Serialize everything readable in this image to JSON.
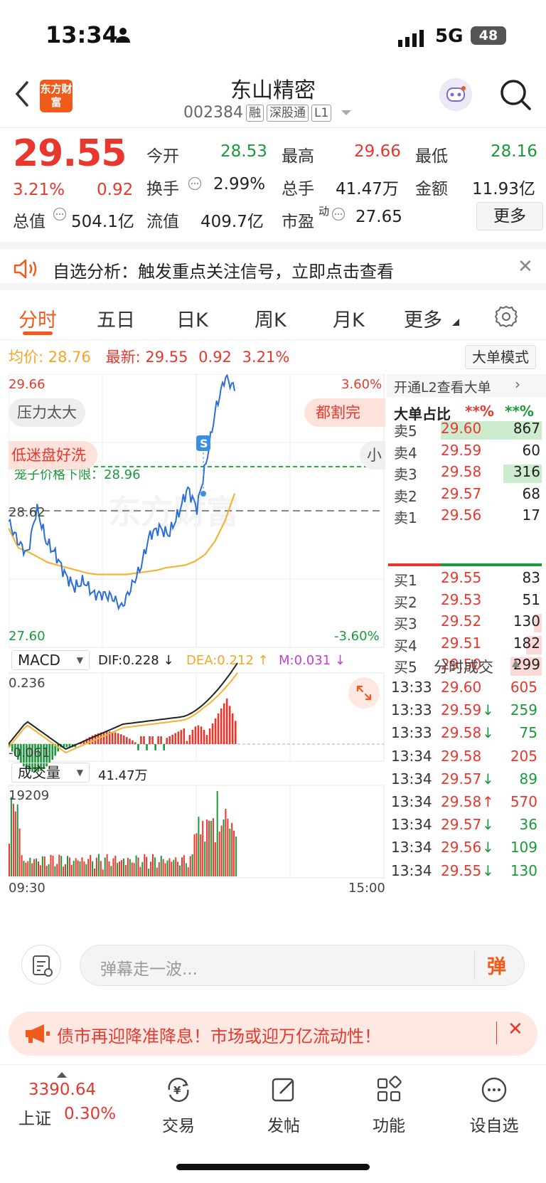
{
  "status_bar": {
    "time": "13:34",
    "network": "5G",
    "battery": "48"
  },
  "header": {
    "logo_text": "东方财富",
    "stock_name": "东山精密",
    "stock_code": "002384",
    "tags": [
      "融",
      "深股通",
      "L1"
    ]
  },
  "quote": {
    "price": "29.55",
    "change_pct": "3.21%",
    "change": "0.92",
    "open_label": "今开",
    "open": "28.53",
    "high_label": "最高",
    "high": "29.66",
    "low_label": "最低",
    "low": "28.16",
    "turnover_label": "换手",
    "turnover": "2.99%",
    "volume_label": "总手",
    "volume": "41.47万",
    "amount_label": "金额",
    "amount": "11.93亿",
    "mcap_label": "总值",
    "mcap": "504.1亿",
    "float_label": "流值",
    "float_cap": "409.7亿",
    "pe_label": "市盈",
    "pe_sup": "动",
    "pe": "27.65",
    "more_label": "更多"
  },
  "banner": {
    "text": "自选分析：触发重点关注信号，立即点击查看"
  },
  "tabs": [
    "分时",
    "五日",
    "日K",
    "周K",
    "月K",
    "更多"
  ],
  "info_line": {
    "avg_label": "均价:",
    "avg": "28.76",
    "last_label": "最新:",
    "last": "29.55",
    "chg": "0.92",
    "pct": "3.21%",
    "big_order_mode": "大单模式"
  },
  "chart": {
    "y_max": "29.66",
    "y_max_pct": "3.60%",
    "y_min": "27.60",
    "y_min_pct": "-3.60%",
    "prev_close": "28.62",
    "limit_label": "笼子价格下限：28.96",
    "bubbles": [
      "压力太大",
      "都割完",
      "低迷盘好洗",
      "小"
    ],
    "watermark": "东方财富",
    "s_marker": "S",
    "macd_label": "MACD",
    "dif": "DIF:0.228 ↓",
    "dea": "DEA:0.212 ↑",
    "m": "M:0.031 ↓",
    "macd_top": "0.236",
    "macd_bottom": "-0.061",
    "vol_label": "成交量",
    "vol_total": "41.47万",
    "vol_max": "19209",
    "time_start": "09:30",
    "time_end": "15:00"
  },
  "chart_data": {
    "type": "line",
    "x_range": [
      "09:30",
      "15:00"
    ],
    "ylim": [
      27.6,
      29.66
    ],
    "series": [
      {
        "name": "最新",
        "values": [
          28.55,
          28.4,
          28.3,
          28.65,
          28.4,
          28.3,
          28.15,
          28.05,
          28.1,
          28.0,
          28.0,
          27.98,
          27.9,
          28.05,
          28.2,
          28.45,
          28.5,
          28.45,
          28.6,
          28.8,
          28.65,
          29.0,
          29.4,
          29.64,
          29.55
        ]
      },
      {
        "name": "均价",
        "values": [
          28.5,
          28.35,
          28.32,
          28.28,
          28.24,
          28.22,
          28.2,
          28.18,
          28.16,
          28.15,
          28.15,
          28.15,
          28.15,
          28.16,
          28.17,
          28.18,
          28.2,
          28.21,
          28.22,
          28.25,
          28.3,
          28.4,
          28.55,
          28.76
        ]
      }
    ]
  },
  "panel": {
    "l2_label": "开通L2查看大单",
    "big_ratio_label": "大单占比",
    "big_ratio_1": "**%",
    "big_ratio_2": "**%",
    "asks": [
      {
        "label": "卖5",
        "price": "29.60",
        "vol": "867",
        "bar": 0.65
      },
      {
        "label": "卖4",
        "price": "29.59",
        "vol": "60",
        "bar": 0.0
      },
      {
        "label": "卖3",
        "price": "29.58",
        "vol": "316",
        "bar": 0.25
      },
      {
        "label": "卖2",
        "price": "29.57",
        "vol": "68",
        "bar": 0.0
      },
      {
        "label": "卖1",
        "price": "29.56",
        "vol": "17",
        "bar": 0.0
      }
    ],
    "bids": [
      {
        "label": "买1",
        "price": "29.55",
        "vol": "83",
        "bar": 0.0
      },
      {
        "label": "买2",
        "price": "29.53",
        "vol": "51",
        "bar": 0.0
      },
      {
        "label": "买3",
        "price": "29.52",
        "vol": "130",
        "bar": 0.05
      },
      {
        "label": "买4",
        "price": "29.51",
        "vol": "182",
        "bar": 0.1
      },
      {
        "label": "买5",
        "price": "29.50",
        "vol": "299",
        "bar": 0.2
      }
    ],
    "trades_title": "分时成交",
    "trades": [
      {
        "time": "13:33",
        "price": "29.60",
        "arrow": "",
        "vol": "605"
      },
      {
        "time": "13:33",
        "price": "29.59",
        "arrow": "↓",
        "vol": "259"
      },
      {
        "time": "13:33",
        "price": "29.58",
        "arrow": "↓",
        "vol": "75"
      },
      {
        "time": "13:34",
        "price": "29.58",
        "arrow": "",
        "vol": "205"
      },
      {
        "time": "13:34",
        "price": "29.57",
        "arrow": "↓",
        "vol": "89"
      },
      {
        "time": "13:34",
        "price": "29.58",
        "arrow": "↑",
        "vol": "570"
      },
      {
        "time": "13:34",
        "price": "29.57",
        "arrow": "↓",
        "vol": "36"
      },
      {
        "time": "13:34",
        "price": "29.56",
        "arrow": "↓",
        "vol": "109"
      },
      {
        "time": "13:34",
        "price": "29.55",
        "arrow": "↓",
        "vol": "130"
      }
    ]
  },
  "comment": {
    "placeholder": "弹幕走一波...",
    "danmu_btn": "弹"
  },
  "notice": {
    "text": "债市再迎降准降息！市场或迎万亿流动性！"
  },
  "tabbar": {
    "index_value": "3390.64",
    "index_name": "上证",
    "index_pct": "0.30%",
    "items": [
      "交易",
      "发帖",
      "功能",
      "设自选"
    ]
  },
  "colors": {
    "up": "#e8382e",
    "down": "#1a9a3a",
    "accent": "#f25a1a",
    "price_line": "#2b6fd6",
    "avg_line": "#f5b335"
  }
}
